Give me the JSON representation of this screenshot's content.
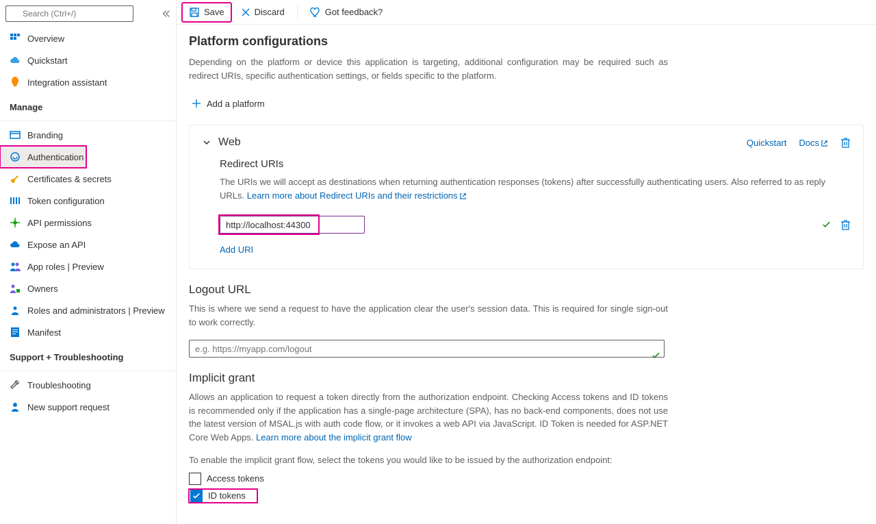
{
  "search": {
    "placeholder": "Search (Ctrl+/)"
  },
  "nav": {
    "overview": "Overview",
    "quickstart": "Quickstart",
    "integration": "Integration assistant",
    "group_manage": "Manage",
    "branding": "Branding",
    "authentication": "Authentication",
    "certificates": "Certificates & secrets",
    "token_config": "Token configuration",
    "api_permissions": "API permissions",
    "expose_api": "Expose an API",
    "app_roles": "App roles | Preview",
    "owners": "Owners",
    "roles_admins": "Roles and administrators | Preview",
    "manifest": "Manifest",
    "group_support": "Support + Troubleshooting",
    "troubleshooting": "Troubleshooting",
    "new_request": "New support request"
  },
  "toolbar": {
    "save": "Save",
    "discard": "Discard",
    "feedback": "Got feedback?"
  },
  "platform": {
    "title": "Platform configurations",
    "desc": "Depending on the platform or device this application is targeting, additional configuration may be required such as redirect URIs, specific authentication settings, or fields specific to the platform.",
    "add": "Add a platform"
  },
  "web": {
    "title": "Web",
    "quickstart": "Quickstart",
    "docs": "Docs",
    "redirect_title": "Redirect URIs",
    "redirect_desc": "The URIs we will accept as destinations when returning authentication responses (tokens) after successfully authenticating users. Also referred to as reply URLs. ",
    "redirect_link": "Learn more about Redirect URIs and their restrictions",
    "uri_value": "http://localhost:44300",
    "add_uri": "Add URI"
  },
  "logout": {
    "title": "Logout URL",
    "desc": "This is where we send a request to have the application clear the user's session data. This is required for single sign-out to work correctly.",
    "placeholder": "e.g. https://myapp.com/logout"
  },
  "implicit": {
    "title": "Implicit grant",
    "desc": "Allows an application to request a token directly from the authorization endpoint. Checking Access tokens and ID tokens is recommended only if the application has a single-page architecture (SPA), has no back-end components, does not use the latest version of MSAL.js with auth code flow, or it invokes a web API via JavaScript. ID Token is needed for ASP.NET Core Web Apps. ",
    "link": "Learn more about the implicit grant flow",
    "enable_prompt": "To enable the implicit grant flow, select the tokens you would like to be issued by the authorization endpoint:",
    "access_tokens": "Access tokens",
    "id_tokens": "ID tokens"
  }
}
